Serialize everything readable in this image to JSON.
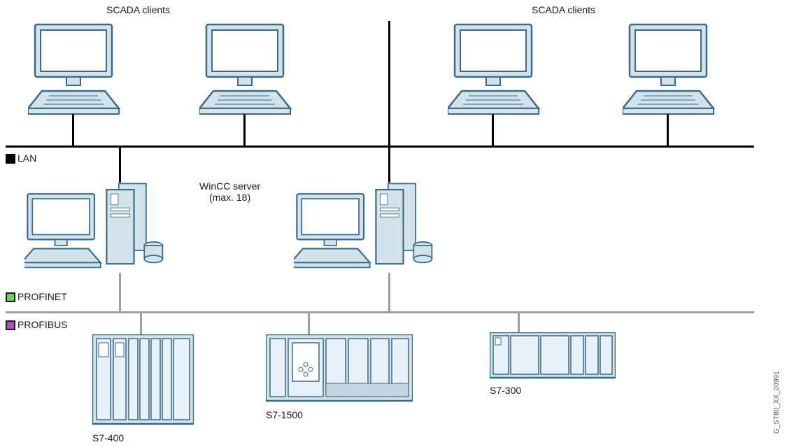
{
  "title_top_left": "SCADA clients",
  "title_top_right": "SCADA clients",
  "wincc_server_label": "WinCC server\n(max. 18)",
  "legend": {
    "lan": "LAN",
    "profinet": "PROFINET",
    "profibus": "PROFIBUS"
  },
  "plc": {
    "s7_400": "S7-400",
    "s7_1500": "S7-1500",
    "s7_300": "S7-300"
  },
  "side_code": "G_ST80_XX_00991",
  "diagram": {
    "type": "network-topology",
    "layers": [
      {
        "name": "LAN",
        "color": "black",
        "nodes": [
          {
            "type": "client-pc",
            "count": 4,
            "label": "SCADA clients"
          }
        ]
      },
      {
        "name": "WinCC servers",
        "connected_to": [
          "LAN",
          "PROFINET"
        ],
        "nodes": [
          {
            "type": "server",
            "count": 2,
            "label": "WinCC server (max. 18)"
          }
        ]
      },
      {
        "name": "PROFINET",
        "color": "gray",
        "also_legend": "PROFIBUS",
        "nodes": [
          {
            "type": "plc",
            "model": "S7-400"
          },
          {
            "type": "plc",
            "model": "S7-1500"
          },
          {
            "type": "plc",
            "model": "S7-300"
          }
        ]
      }
    ]
  }
}
